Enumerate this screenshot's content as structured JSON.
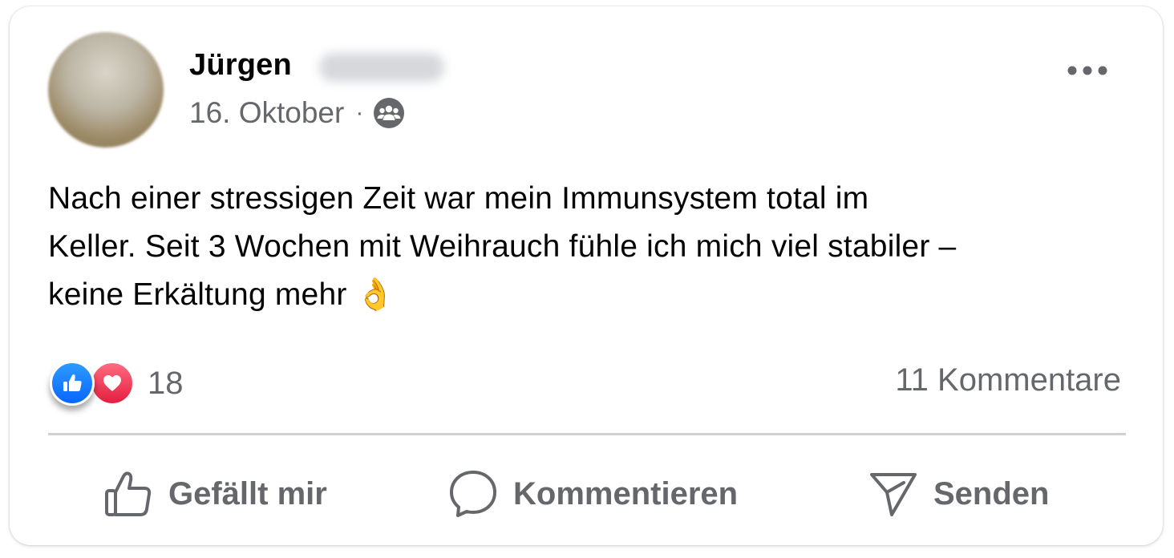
{
  "post": {
    "author_first_name": "Jürgen",
    "date": "16. Oktober",
    "separator": "·",
    "audience_icon": "friends-icon",
    "more_icon": "more-options-icon",
    "text_lines": [
      "Nach einer stressigen Zeit war mein Immunsystem total im",
      "Keller. Seit 3 Wochen mit Weihrauch fühle ich mich viel stabiler –",
      "keine Erkältung mehr"
    ],
    "emoji": "👌",
    "reactions": {
      "types": [
        "like-icon",
        "love-icon"
      ],
      "count": "18"
    },
    "comments_label": "11 Kommentare"
  },
  "actions": {
    "like_label": "Gefällt mir",
    "comment_label": "Kommentieren",
    "send_label": "Senden"
  },
  "colors": {
    "text_primary": "#050505",
    "text_secondary": "#65676b",
    "like_blue": "#0866ff",
    "love_red": "#e41e3f",
    "divider": "#ced0d4"
  }
}
